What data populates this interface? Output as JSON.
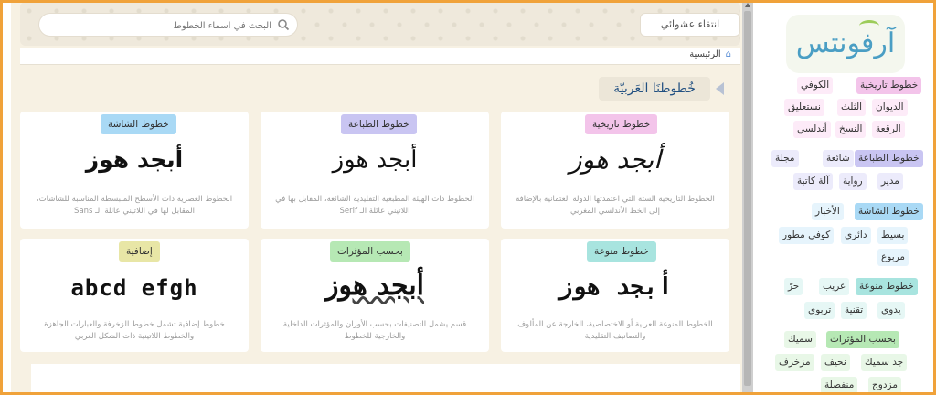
{
  "header": {
    "random_label": "انتقاء عشوائي",
    "search_placeholder": "البحث في أسماء الخطوط"
  },
  "breadcrumb": {
    "home": "الرئيسية"
  },
  "section_title": "خُطوطنَا العَربيّة",
  "cards": [
    {
      "badge": "خطوط تاريخية",
      "badge_color": "#f3c4ea",
      "sample": "أبجد هوز",
      "desc": "الخطوط التاريخية الستة التي اعتمدتها الدولة العثمانية بالإضافة إلى الخط الأندلسي المغربي"
    },
    {
      "badge": "خطوط الطباعة",
      "badge_color": "#c9c5f2",
      "sample": "أبجد هوز",
      "desc": "الخطوط ذات الهيئة المطبعية التقليدية الشائعة، المقابل بها في اللاتيني عائلة الـ Serif"
    },
    {
      "badge": "خطوط الشاشة",
      "badge_color": "#a9d9f5",
      "sample": "أبجد هوز",
      "desc": "الخطوط العصرية ذات الأسطح المنبسطة المناسبة للشاشات، المقابل لها في اللاتيني عائلة الـ Sans"
    },
    {
      "badge": "خطوط منوعة",
      "badge_color": "#a8e4df",
      "sample": "أبجد هوز",
      "desc": "الخطوط المنوعة العربية أو الاختصاصية، الخارجة عن المألوف والتصانيف التقليدية"
    },
    {
      "badge": "بحسب المؤثرات",
      "badge_color": "#b6e8b4",
      "sample": "أبجد هوز",
      "desc": "قسم يشمل التصنيفات بحسب الأوزان والمؤثرات الداخلية والخارجية للخطوط"
    },
    {
      "badge": "إضافية",
      "badge_color": "#e8e6a6",
      "sample": "abcd efgh",
      "desc": "خطوط إضافية تشمل خطوط الزخرفة والعبارات الجاهزة والخطوط اللاتينية ذات الشكل العربي"
    }
  ],
  "sidebar": {
    "logo": "آرفونتس",
    "groups": [
      {
        "head": "خطوط تاريخية",
        "color": "#f3c4ea",
        "items": [
          "الكوفي",
          "الديوان",
          "الثلث",
          "نستعليق",
          "الرقعة",
          "النسخ",
          "أندلسي"
        ]
      },
      {
        "head": "خطوط الطباعة",
        "color": "#c9c5f2",
        "items": [
          "شائعة",
          "مجلة",
          "مدير",
          "رواية",
          "آلة كاتبة"
        ]
      },
      {
        "head": "خطوط الشاشة",
        "color": "#a9d9f5",
        "items": [
          "الأخبار",
          "بسيط",
          "دائري",
          "كوفي مطور",
          "مربوع"
        ]
      },
      {
        "head": "خطوط منوعة",
        "color": "#a8e4df",
        "items": [
          "غريب",
          "حرّ",
          "يدوي",
          "تقنية",
          "تربوي"
        ]
      },
      {
        "head": "بحسب المؤثرات",
        "color": "#b6e8b4",
        "items": [
          "سميك",
          "جد سميك",
          "نحيف",
          "مزخرف",
          "مزدوج",
          "منفصلة"
        ]
      }
    ]
  }
}
